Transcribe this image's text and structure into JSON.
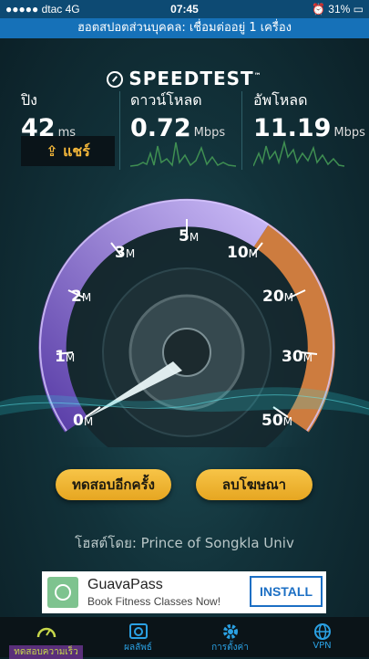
{
  "status": {
    "carrier": "dtac",
    "network": "4G",
    "time": "07:45",
    "battery": "31%"
  },
  "hotspot": "ฮอตสปอตส่วนบุคคล: เชื่อมต่ออยู่ 1 เครื่อง",
  "brand": "SPEEDTEST",
  "ping": {
    "label": "ปิง",
    "value": "42",
    "unit": "ms"
  },
  "download": {
    "label": "ดาวน์โหลด",
    "value": "0.72",
    "unit": "Mbps"
  },
  "upload": {
    "label": "อัพโหลด",
    "value": "11.19",
    "unit": "Mbps"
  },
  "share_label": "แชร์",
  "gauge": {
    "labels": [
      {
        "n": "0",
        "u": "M"
      },
      {
        "n": "1",
        "u": "M"
      },
      {
        "n": "2",
        "u": "M"
      },
      {
        "n": "3",
        "u": "M"
      },
      {
        "n": "5",
        "u": "M"
      },
      {
        "n": "10",
        "u": "M"
      },
      {
        "n": "20",
        "u": "M"
      },
      {
        "n": "30",
        "u": "M"
      },
      {
        "n": "50",
        "u": "M"
      }
    ],
    "needle_value_mbps": 0.72
  },
  "buttons": {
    "retest": "ทดสอบอีกครั้ง",
    "remove_ads": "ลบโฆษณา"
  },
  "host": "โฮสต์โดย: Prince of Songkla Univ",
  "ad": {
    "name": "GuavaPass",
    "subtitle": "Book Fitness Classes Now!",
    "cta": "INSTALL"
  },
  "tabs": [
    {
      "label": "ทดสอบความเร็ว",
      "icon": "speedometer-icon",
      "active": true
    },
    {
      "label": "ผลลัพธ์",
      "icon": "results-icon",
      "active": false
    },
    {
      "label": "การตั้งค่า",
      "icon": "gear-icon",
      "active": false
    },
    {
      "label": "VPN",
      "icon": "vpn-icon",
      "active": false
    }
  ],
  "colors": {
    "accent": "#f4b73a",
    "tab_blue": "#2ba1e3",
    "gauge_purple": "#9b7be0",
    "gauge_orange": "#f08a32"
  }
}
